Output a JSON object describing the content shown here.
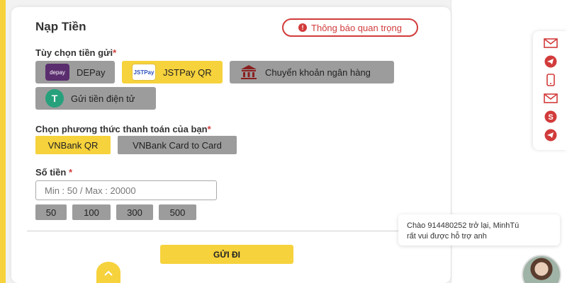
{
  "title": "Nạp Tiền",
  "notice_button": "Thông báo quan trọng",
  "deposit_options": {
    "label": "Tùy chọn tiền gửi",
    "required_mark": "*",
    "items": [
      {
        "label": "DEPay",
        "logo_text": "depay",
        "active": false
      },
      {
        "label": "JSTPay QR",
        "logo_text": "JSTPay",
        "active": true
      },
      {
        "label": "Chuyển khoản ngân hàng",
        "active": false
      },
      {
        "label": "Gửi tiền điện tử",
        "active": false
      }
    ]
  },
  "payment_method": {
    "label": "Chọn phương thức thanh toán của bạn",
    "required_mark": "*",
    "items": [
      {
        "label": "VNBank QR",
        "active": true
      },
      {
        "label": "VNBank Card to Card",
        "active": false
      }
    ]
  },
  "amount": {
    "label": "Số tiền",
    "required_mark": "*",
    "placeholder": "Min : 50 / Max : 20000",
    "quick_amounts": [
      "50",
      "100",
      "300",
      "500"
    ]
  },
  "submit_label": "GỬI ĐI",
  "chat": {
    "line1": "Chào 914480252 trở lại, MinhTú",
    "line2": "rất vui được hỗ trợ anh"
  },
  "side_icons": [
    "mail-icon",
    "telegram-icon",
    "phone-icon",
    "mail-icon",
    "skype-icon",
    "telegram-icon"
  ],
  "colors": {
    "accent": "#f6d23c",
    "danger": "#d23b3b",
    "option_bg": "#9c9c9c"
  }
}
